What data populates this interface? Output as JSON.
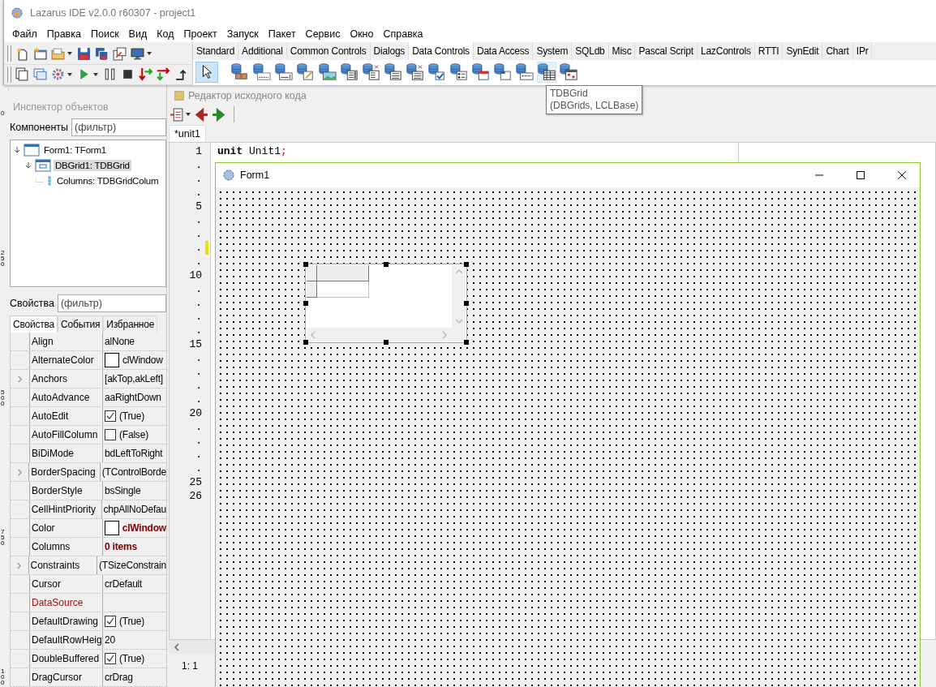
{
  "main_window": {
    "title": "Lazarus IDE v2.0.0 r60307 - project1",
    "menu": [
      "Файл",
      "Правка",
      "Поиск",
      "Вид",
      "Код",
      "Проект",
      "Запуск",
      "Пакет",
      "Сервис",
      "Окно",
      "Справка"
    ],
    "palette": {
      "tabs": [
        {
          "label": "Standard",
          "selected": false
        },
        {
          "label": "Additional",
          "selected": false
        },
        {
          "label": "Common Controls",
          "selected": false
        },
        {
          "label": "Dialogs",
          "selected": false
        },
        {
          "label": "Data Controls",
          "selected": true
        },
        {
          "label": "Data Access",
          "selected": false
        },
        {
          "label": "System",
          "selected": false
        },
        {
          "label": "SQLdb",
          "selected": false
        },
        {
          "label": "Misc",
          "selected": false
        },
        {
          "label": "Pascal Script",
          "selected": false
        },
        {
          "label": "LazControls",
          "selected": false
        },
        {
          "label": "RTTI",
          "selected": false
        },
        {
          "label": "SynEdit",
          "selected": false
        },
        {
          "label": "Chart",
          "selected": false
        },
        {
          "label": "IPr",
          "selected": false
        }
      ],
      "components": [
        {
          "kind": "pointer",
          "selected": true,
          "hovered": false
        },
        {
          "kind": "navigator",
          "selected": false,
          "hovered": false
        },
        {
          "kind": "text",
          "selected": false,
          "hovered": false
        },
        {
          "kind": "edit",
          "selected": false,
          "hovered": false
        },
        {
          "kind": "memo",
          "selected": false,
          "hovered": false
        },
        {
          "kind": "image",
          "selected": false,
          "hovered": false
        },
        {
          "kind": "listbox",
          "selected": false,
          "hovered": false
        },
        {
          "kind": "lookup-listbox",
          "selected": false,
          "hovered": false
        },
        {
          "kind": "combobox",
          "selected": false,
          "hovered": false
        },
        {
          "kind": "lookup-combobox",
          "selected": false,
          "hovered": false
        },
        {
          "kind": "checkbox",
          "selected": false,
          "hovered": false
        },
        {
          "kind": "radiogroup",
          "selected": false,
          "hovered": false
        },
        {
          "kind": "calendar",
          "selected": false,
          "hovered": false
        },
        {
          "kind": "groupbox",
          "selected": false,
          "hovered": false
        },
        {
          "kind": "date-edit",
          "selected": false,
          "hovered": false
        },
        {
          "kind": "grid",
          "selected": false,
          "hovered": true
        },
        {
          "kind": "datetime",
          "selected": false,
          "hovered": false
        }
      ]
    }
  },
  "tooltip": {
    "lines": [
      "TDBGrid",
      "(DBGrids, LCLBase)"
    ]
  },
  "ruler": [
    "0",
    "250",
    "500",
    "750",
    "100"
  ],
  "inspector": {
    "title": "Инспектор объектов",
    "components_label": "Компоненты",
    "components_filter": {
      "placeholder": "(фильтр)"
    },
    "tree": [
      {
        "label": "Form1: TForm1",
        "kind": "form",
        "expanded": true,
        "selected": false,
        "children": [
          {
            "label": "DBGrid1: TDBGrid",
            "kind": "grid",
            "expanded": true,
            "selected": true,
            "children": [
              {
                "label": "Columns: TDBGridColum",
                "kind": "collection",
                "selected": false
              }
            ]
          }
        ]
      }
    ],
    "properties_label": "Свойства",
    "properties_filter": {
      "placeholder": "(фильтр)"
    },
    "tabs": [
      {
        "label": "Свойства",
        "selected": true
      },
      {
        "label": "События",
        "selected": false
      },
      {
        "label": "Избранное",
        "selected": false
      }
    ],
    "properties": [
      {
        "name": "Align",
        "kind": "text",
        "value": "alNone",
        "expandable": false,
        "modified": false,
        "required": false
      },
      {
        "name": "AlternateColor",
        "kind": "color",
        "value": "clWindow",
        "expandable": false,
        "modified": false,
        "required": false
      },
      {
        "name": "Anchors",
        "kind": "text",
        "value": "[akTop,akLeft]",
        "expandable": true,
        "modified": false,
        "required": false
      },
      {
        "name": "AutoAdvance",
        "kind": "text",
        "value": "aaRightDown",
        "expandable": false,
        "modified": false,
        "required": false
      },
      {
        "name": "AutoEdit",
        "kind": "bool",
        "value": "(True)",
        "checked": true,
        "expandable": false,
        "modified": false,
        "required": false
      },
      {
        "name": "AutoFillColumn",
        "kind": "bool",
        "value": "(False)",
        "checked": false,
        "expandable": false,
        "modified": false,
        "required": false
      },
      {
        "name": "BiDiMode",
        "kind": "text",
        "value": "bdLeftToRight",
        "expandable": false,
        "modified": false,
        "required": false
      },
      {
        "name": "BorderSpacing",
        "kind": "text",
        "value": "(TControlBorde",
        "expandable": true,
        "modified": false,
        "required": false
      },
      {
        "name": "BorderStyle",
        "kind": "text",
        "value": "bsSingle",
        "expandable": false,
        "modified": false,
        "required": false
      },
      {
        "name": "CellHintPriority",
        "kind": "text",
        "value": "chpAllNoDefau",
        "expandable": false,
        "modified": false,
        "required": false
      },
      {
        "name": "Color",
        "kind": "color",
        "value": "clWindow",
        "expandable": false,
        "modified": true,
        "required": false
      },
      {
        "name": "Columns",
        "kind": "text",
        "value": "0 items",
        "expandable": false,
        "modified": true,
        "required": false
      },
      {
        "name": "Constraints",
        "kind": "text",
        "value": "(TSizeConstrain",
        "expandable": true,
        "modified": false,
        "required": false
      },
      {
        "name": "Cursor",
        "kind": "text",
        "value": "crDefault",
        "expandable": false,
        "modified": false,
        "required": false
      },
      {
        "name": "DataSource",
        "kind": "text",
        "expandable": false,
        "required": true
      },
      {
        "name": "DefaultDrawing",
        "kind": "bool",
        "value": "(True)",
        "checked": true,
        "expandable": false,
        "modified": false,
        "required": false
      },
      {
        "name": "DefaultRowHeig",
        "kind": "text",
        "value": "20",
        "expandable": false,
        "modified": false,
        "required": false
      },
      {
        "name": "DoubleBuffered",
        "kind": "bool",
        "value": "(True)",
        "checked": true,
        "expandable": false,
        "modified": false,
        "required": false
      },
      {
        "name": "DragCursor",
        "kind": "text",
        "value": "crDrag",
        "expandable": false,
        "modified": false,
        "required": false
      }
    ]
  },
  "editor": {
    "title": "Редактор исходного кода",
    "tabs": [
      {
        "label": "*unit1",
        "selected": true
      }
    ],
    "gutter": [
      {
        "text": "1",
        "changed": false
      },
      {
        "text": ".",
        "changed": false
      },
      {
        "text": ".",
        "changed": false
      },
      {
        "text": ".",
        "changed": false
      },
      {
        "text": "5",
        "changed": false
      },
      {
        "text": ".",
        "changed": false
      },
      {
        "text": ".",
        "changed": false
      },
      {
        "text": ".",
        "changed": true
      },
      {
        "text": ".",
        "changed": false
      },
      {
        "text": "10",
        "changed": false
      },
      {
        "text": ".",
        "changed": false
      },
      {
        "text": ".",
        "changed": false
      },
      {
        "text": ".",
        "changed": false
      },
      {
        "text": ".",
        "changed": false
      },
      {
        "text": "15",
        "changed": false
      },
      {
        "text": ".",
        "changed": false
      },
      {
        "text": ".",
        "changed": false
      },
      {
        "text": ".",
        "changed": false
      },
      {
        "text": ".",
        "changed": false
      },
      {
        "text": "20",
        "changed": false
      },
      {
        "text": ".",
        "changed": false
      },
      {
        "text": ".",
        "changed": false
      },
      {
        "text": ".",
        "changed": false
      },
      {
        "text": ".",
        "changed": false
      },
      {
        "text": "25",
        "changed": false
      },
      {
        "text": "26",
        "changed": false
      }
    ],
    "code": [
      [
        {
          "text": "unit",
          "kind": "keyword"
        },
        {
          "text": " Unit1",
          "kind": "ident"
        },
        {
          "text": ";",
          "kind": "symbol"
        }
      ]
    ],
    "status": "1: 1"
  },
  "form": {
    "title": "Form1"
  }
}
